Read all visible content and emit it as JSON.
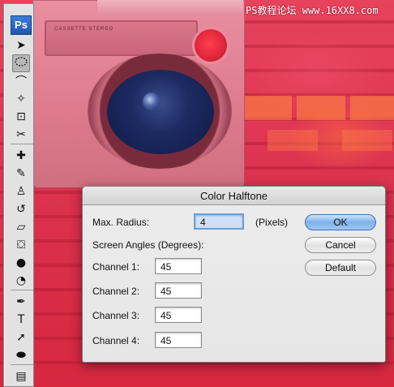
{
  "watermark": "PS教程论坛 www.16XX8.com",
  "canvas": {
    "deck_label": "CASSETTE STEREO"
  },
  "toolbox": {
    "logo": "Ps",
    "tools": [
      {
        "name": "move-tool",
        "icon": "move-icon",
        "glyph": "➤"
      },
      {
        "name": "elliptical-marquee-tool",
        "icon": "ellipse-marquee-icon",
        "glyph": "",
        "selected": true
      },
      {
        "name": "lasso-tool",
        "icon": "lasso-icon",
        "glyph": "⌒"
      },
      {
        "name": "magic-wand-tool",
        "icon": "magic-wand-icon",
        "glyph": "✧"
      },
      {
        "name": "crop-tool",
        "icon": "crop-icon",
        "glyph": "⊡"
      },
      {
        "name": "slice-tool",
        "icon": "slice-icon",
        "glyph": "✂"
      },
      {
        "name": "healing-brush-tool",
        "icon": "bandage-icon",
        "glyph": "✚"
      },
      {
        "name": "brush-tool",
        "icon": "brush-icon",
        "glyph": "✎"
      },
      {
        "name": "clone-stamp-tool",
        "icon": "stamp-icon",
        "glyph": "♙"
      },
      {
        "name": "history-brush-tool",
        "icon": "history-brush-icon",
        "glyph": "↺"
      },
      {
        "name": "eraser-tool",
        "icon": "eraser-icon",
        "glyph": "▱"
      },
      {
        "name": "paint-bucket-tool",
        "icon": "bucket-icon",
        "glyph": "⛋"
      },
      {
        "name": "blur-tool",
        "icon": "droplet-icon",
        "glyph": "●"
      },
      {
        "name": "dodge-tool",
        "icon": "dodge-icon",
        "glyph": "◔"
      },
      {
        "name": "pen-tool",
        "icon": "pen-icon",
        "glyph": "✒"
      },
      {
        "name": "type-tool",
        "icon": "type-icon",
        "glyph": "T"
      },
      {
        "name": "path-selection-tool",
        "icon": "arrow-icon",
        "glyph": "➚"
      },
      {
        "name": "ellipse-shape-tool",
        "icon": "ellipse-shape-icon",
        "glyph": "⬬"
      },
      {
        "name": "notes-tool",
        "icon": "notes-icon",
        "glyph": "▤"
      }
    ]
  },
  "dialog": {
    "title": "Color Halftone",
    "max_radius_label": "Max. Radius:",
    "max_radius_value": "4",
    "pixels_label": "(Pixels)",
    "screen_angles_label": "Screen Angles (Degrees):",
    "channels": [
      {
        "label": "Channel 1:",
        "value": "45"
      },
      {
        "label": "Channel 2:",
        "value": "45"
      },
      {
        "label": "Channel 3:",
        "value": "45"
      },
      {
        "label": "Channel 4:",
        "value": "45"
      }
    ],
    "ok_label": "OK",
    "cancel_label": "Cancel",
    "default_label": "Default"
  }
}
